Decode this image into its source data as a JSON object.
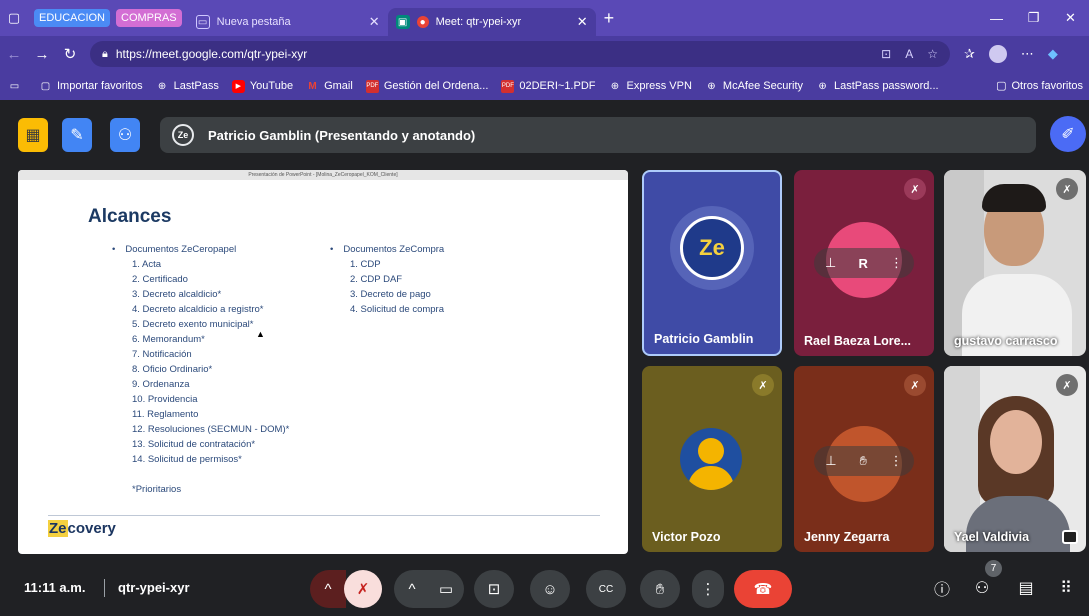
{
  "browser": {
    "tab_groups": [
      {
        "label": "EDUCACION",
        "color": "#4b8bf5"
      },
      {
        "label": "COMPRAS",
        "color": "#d36ed4"
      }
    ],
    "tabs": [
      {
        "title": "Nueva pestaña",
        "icon": "new-tab-icon"
      },
      {
        "title": "Meet: qtr-ypei-xyr",
        "icon": "meet-icon",
        "active": true
      }
    ],
    "url": "https://meet.google.com/qtr-ypei-xyr",
    "bookmarks": [
      {
        "label": "Importar favoritos",
        "icon": "import-icon"
      },
      {
        "label": "LastPass",
        "icon": "globe-icon"
      },
      {
        "label": "YouTube",
        "icon": "youtube-icon"
      },
      {
        "label": "Gmail",
        "icon": "gmail-icon"
      },
      {
        "label": "Gestión del Ordena...",
        "icon": "pdf-icon"
      },
      {
        "label": "02DERI~1.PDF",
        "icon": "pdf-icon"
      },
      {
        "label": "Express VPN",
        "icon": "globe-icon"
      },
      {
        "label": "McAfee Security",
        "icon": "globe-icon"
      },
      {
        "label": "LastPass password...",
        "icon": "globe-icon"
      }
    ],
    "other_favorites": "Otros favoritos",
    "accent": "#4a3ca0"
  },
  "meet": {
    "presenter_logo": "Ze",
    "presenter_banner": "Patricio Gamblin (Presentando y anotando)",
    "slide": {
      "window_title": "Presentación de PowerPoint - [Molina_ZeCeropapel_KOM_Cliente]",
      "title": "Alcances",
      "col1_header": "Documentos ZeCeropapel",
      "col1_items": [
        "1.  Acta",
        "2.  Certificado",
        "3.  Decreto alcaldicio*",
        "4.  Decreto alcaldicio a registro*",
        "5.  Decreto exento municipal*",
        "6.  Memorandum*",
        "7.  Notificación",
        "8.  Oficio Ordinario*",
        "9.  Ordenanza",
        "10. Providencia",
        "11. Reglamento",
        "12. Resoluciones (SECMUN - DOM)*",
        "13. Solicitud de contratación*",
        "14. Solicitud de permisos*"
      ],
      "col2_header": "Documentos ZeCompra",
      "col2_items": [
        "1.  CDP",
        "2.  CDP DAF",
        "3.  Decreto de pago",
        "4.  Solicitud de compra"
      ],
      "note": "*Prioritarios",
      "logo_ze": "Ze",
      "logo_rest": "covery"
    },
    "participants": [
      {
        "name": "Patricio Gamblin",
        "initials": "Ze"
      },
      {
        "name": "Rael Baeza Lore...",
        "initials": "R"
      },
      {
        "name": "gustavo carrasco"
      },
      {
        "name": "Victor Pozo"
      },
      {
        "name": "Jenny Zegarra"
      },
      {
        "name": "Yael Valdivia"
      }
    ],
    "time": "11:11 a.m.",
    "meeting_code": "qtr-ypei-xyr",
    "participant_count": "7",
    "end_call_color": "#ea4335"
  }
}
